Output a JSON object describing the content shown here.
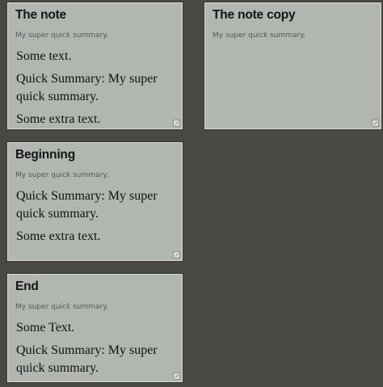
{
  "notes": [
    {
      "title": "The note",
      "summary": "My super quick summary.",
      "paragraphs": [
        "Some text.",
        "Quick Summary: My super quick summary.",
        "Some extra text."
      ]
    },
    {
      "title": "The note copy",
      "summary": "My super quick summary.",
      "paragraphs": []
    },
    {
      "title": "Beginning",
      "summary": "My super quick summary.",
      "paragraphs": [
        "Quick Summary: My super quick summary.",
        "Some extra text."
      ]
    },
    {
      "title": "End",
      "summary": "My super quick summary.",
      "paragraphs": [
        "Some Text.",
        "Quick Summary: My super quick summary."
      ]
    }
  ],
  "icons": {
    "resize": "resize-handle-icon"
  }
}
